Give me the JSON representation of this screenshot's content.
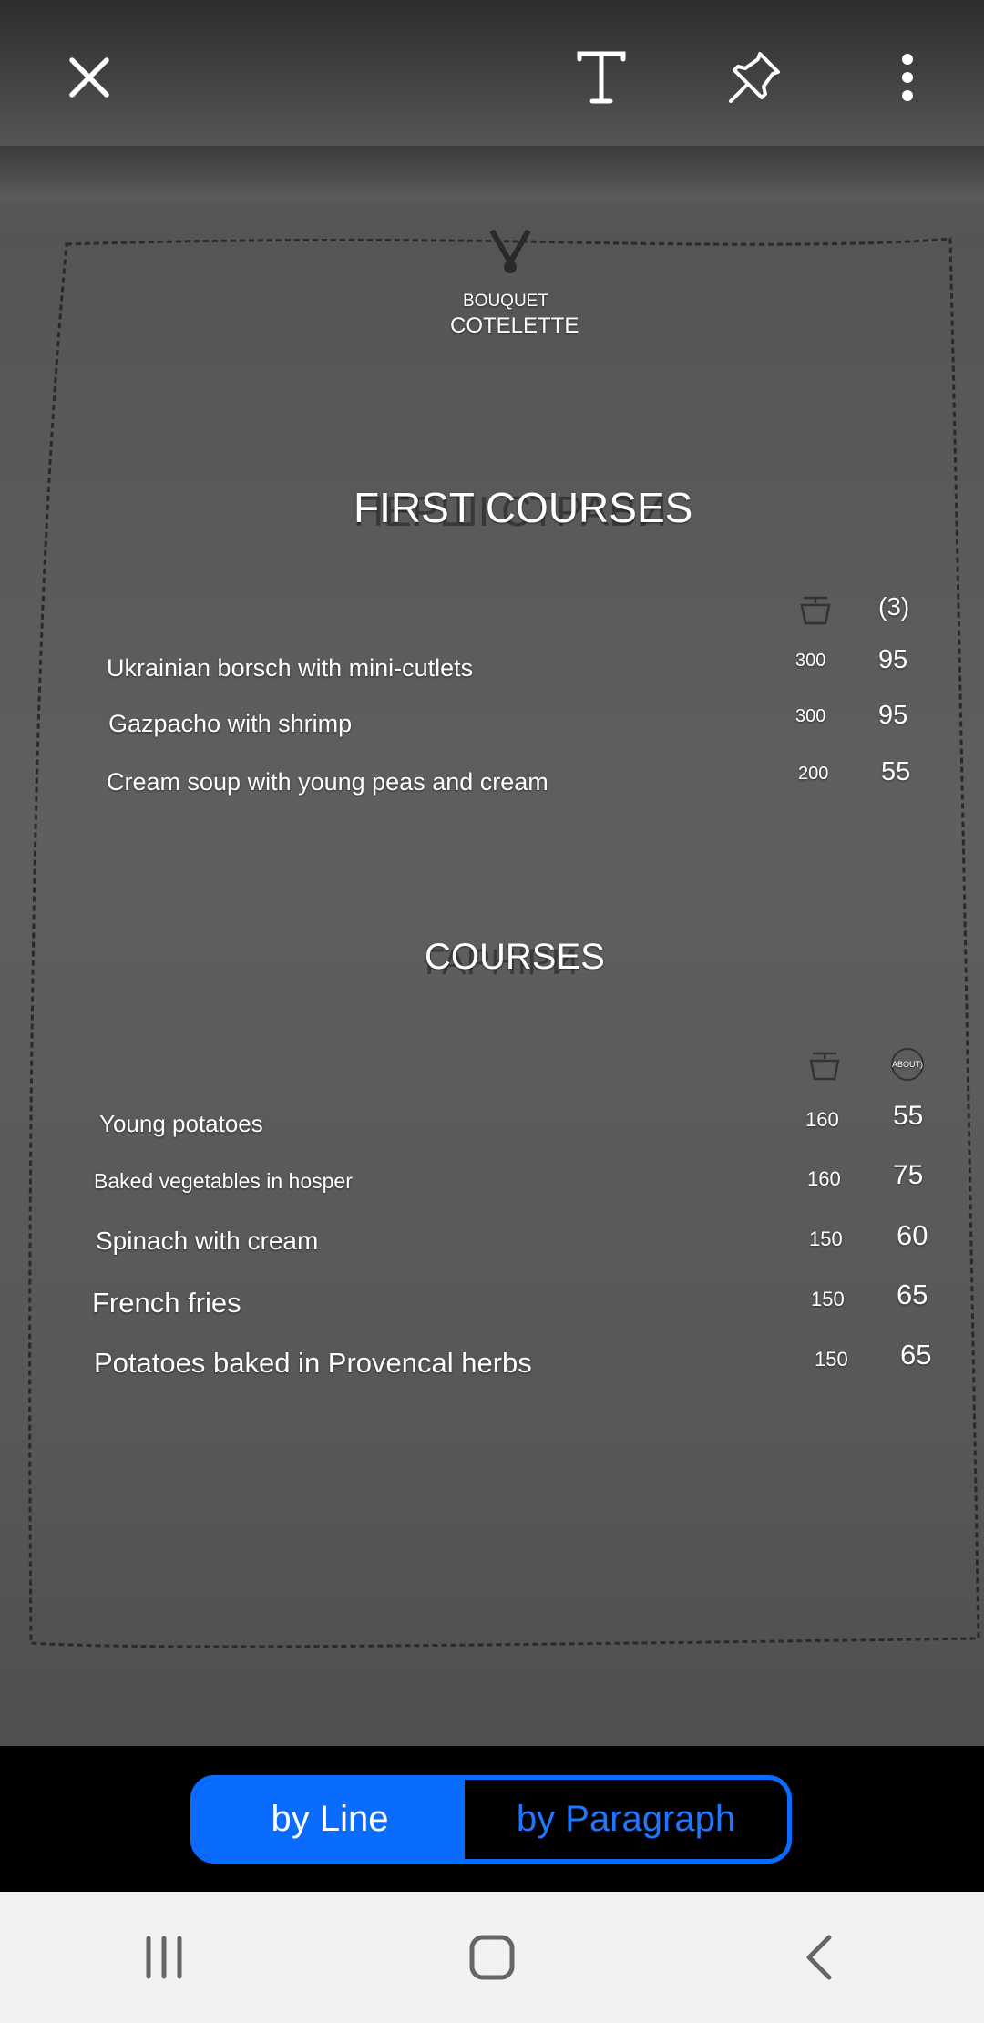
{
  "toolbar": {
    "close_icon": "close-icon",
    "text_icon": "text-icon",
    "pin_icon": "pin-icon",
    "more_icon": "more-vert-icon"
  },
  "menu": {
    "brand_line1": "BOUQUET",
    "brand_line2": "COTELETTE",
    "section1": {
      "title": "FIRST COURSES",
      "header_price": "(3)",
      "items": [
        {
          "name": "Ukrainian borsch with mini-cutlets",
          "weight": "300",
          "price": "95"
        },
        {
          "name": "Gazpacho with shrimp",
          "weight": "300",
          "price": "95"
        },
        {
          "name": "Cream soup with young peas and cream",
          "weight": "200",
          "price": "55"
        }
      ]
    },
    "section2": {
      "title": "COURSES",
      "header_price": "ABOUT)",
      "items": [
        {
          "name": "Young potatoes",
          "weight": "160",
          "price": "55"
        },
        {
          "name": "Baked vegetables in hosper",
          "weight": "160",
          "price": "75"
        },
        {
          "name": "Spinach with cream",
          "weight": "150",
          "price": "60"
        },
        {
          "name": "French fries",
          "weight": "150",
          "price": "65"
        },
        {
          "name": "Potatoes baked in Provencal herbs",
          "weight": "150",
          "price": "65"
        }
      ]
    }
  },
  "segmented": {
    "by_line": "by Line",
    "by_paragraph": "by Paragraph"
  },
  "colors": {
    "accent": "#0a6cff",
    "navbar_bg": "#f2f2f2"
  }
}
